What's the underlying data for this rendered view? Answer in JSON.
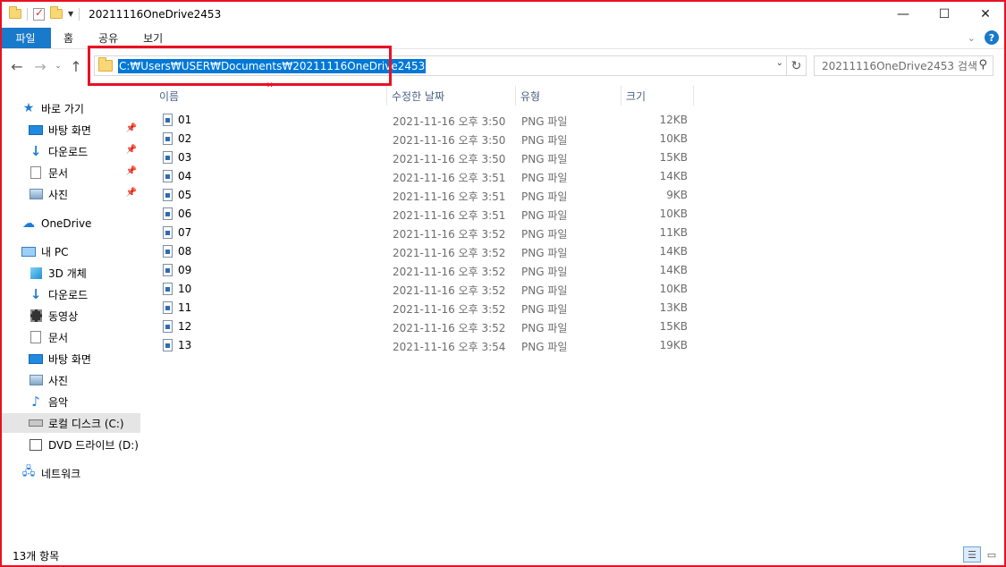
{
  "window": {
    "title": "20211116OneDrive2453",
    "minimize_label": "—",
    "maximize_label": "☐",
    "close_label": "✕"
  },
  "ribbon": {
    "tabs": [
      "파일",
      "홈",
      "공유",
      "보기"
    ]
  },
  "navbar": {
    "back": "←",
    "forward": "→",
    "recent": "⌄",
    "up": "↑",
    "address": "C:₩Users₩USER₩Documents₩20211116OneDrive2453",
    "search_placeholder": "20211116OneDrive2453 검색"
  },
  "sidebar": {
    "quick_access": "바로 가기",
    "quick_items": [
      "바탕 화면",
      "다운로드",
      "문서",
      "사진"
    ],
    "onedrive": "OneDrive",
    "this_pc": "내 PC",
    "pc_items": [
      "3D 개체",
      "다운로드",
      "동영상",
      "문서",
      "바탕 화면",
      "사진",
      "음악",
      "로컬 디스크 (C:)",
      "DVD 드라이브 (D:)"
    ],
    "network": "네트워크"
  },
  "columns": {
    "name": "이름",
    "date": "수정한 날짜",
    "type": "유형",
    "size": "크기"
  },
  "files": [
    {
      "name": "01",
      "date": "2021-11-16 오후 3:50",
      "type": "PNG 파일",
      "size": "12KB"
    },
    {
      "name": "02",
      "date": "2021-11-16 오후 3:50",
      "type": "PNG 파일",
      "size": "10KB"
    },
    {
      "name": "03",
      "date": "2021-11-16 오후 3:50",
      "type": "PNG 파일",
      "size": "15KB"
    },
    {
      "name": "04",
      "date": "2021-11-16 오후 3:51",
      "type": "PNG 파일",
      "size": "14KB"
    },
    {
      "name": "05",
      "date": "2021-11-16 오후 3:51",
      "type": "PNG 파일",
      "size": "9KB"
    },
    {
      "name": "06",
      "date": "2021-11-16 오후 3:51",
      "type": "PNG 파일",
      "size": "10KB"
    },
    {
      "name": "07",
      "date": "2021-11-16 오후 3:52",
      "type": "PNG 파일",
      "size": "11KB"
    },
    {
      "name": "08",
      "date": "2021-11-16 오후 3:52",
      "type": "PNG 파일",
      "size": "14KB"
    },
    {
      "name": "09",
      "date": "2021-11-16 오후 3:52",
      "type": "PNG 파일",
      "size": "14KB"
    },
    {
      "name": "10",
      "date": "2021-11-16 오후 3:52",
      "type": "PNG 파일",
      "size": "10KB"
    },
    {
      "name": "11",
      "date": "2021-11-16 오후 3:52",
      "type": "PNG 파일",
      "size": "13KB"
    },
    {
      "name": "12",
      "date": "2021-11-16 오후 3:52",
      "type": "PNG 파일",
      "size": "15KB"
    },
    {
      "name": "13",
      "date": "2021-11-16 오후 3:54",
      "type": "PNG 파일",
      "size": "19KB"
    }
  ],
  "status": {
    "item_count": "13개 항목"
  },
  "colors": {
    "accent": "#0078d7",
    "file_tab": "#1979ca",
    "annotation": "#e81123"
  }
}
